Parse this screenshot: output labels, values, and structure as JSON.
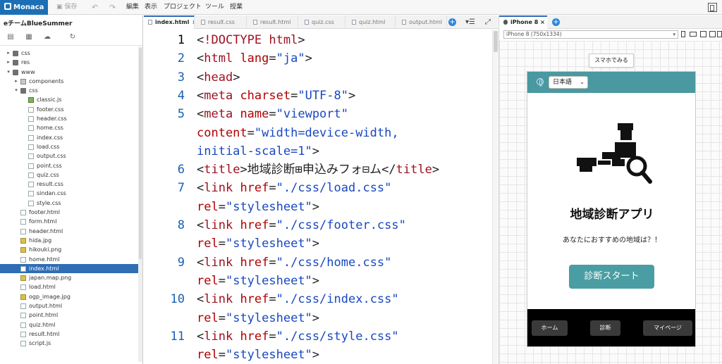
{
  "app": {
    "logo": "Monaca",
    "save_label": "保存",
    "menu": [
      "編集",
      "表示",
      "プロジェクト",
      "ツール",
      "授業"
    ]
  },
  "project": {
    "name": "eチームBlueSummer",
    "tree": [
      {
        "label": "css",
        "kind": "folder",
        "depth": 0,
        "arrow": "▸"
      },
      {
        "label": "res",
        "kind": "folder",
        "depth": 0,
        "arrow": "▸"
      },
      {
        "label": "www",
        "kind": "folder",
        "depth": 0,
        "arrow": "▾"
      },
      {
        "label": "components",
        "kind": "pkg",
        "depth": 1,
        "arrow": "▸"
      },
      {
        "label": "css",
        "kind": "folder",
        "depth": 1,
        "arrow": "▾"
      },
      {
        "label": "classic.js",
        "kind": "js",
        "depth": 2,
        "arrow": ""
      },
      {
        "label": "footer.css",
        "kind": "file",
        "depth": 2,
        "arrow": ""
      },
      {
        "label": "header.css",
        "kind": "file",
        "depth": 2,
        "arrow": ""
      },
      {
        "label": "home.css",
        "kind": "file",
        "depth": 2,
        "arrow": ""
      },
      {
        "label": "index.css",
        "kind": "file",
        "depth": 2,
        "arrow": ""
      },
      {
        "label": "load.css",
        "kind": "file",
        "depth": 2,
        "arrow": ""
      },
      {
        "label": "output.css",
        "kind": "file",
        "depth": 2,
        "arrow": ""
      },
      {
        "label": "point.css",
        "kind": "file",
        "depth": 2,
        "arrow": ""
      },
      {
        "label": "quiz.css",
        "kind": "file",
        "depth": 2,
        "arrow": ""
      },
      {
        "label": "result.css",
        "kind": "file",
        "depth": 2,
        "arrow": ""
      },
      {
        "label": "sindan.css",
        "kind": "file",
        "depth": 2,
        "arrow": ""
      },
      {
        "label": "style.css",
        "kind": "file",
        "depth": 2,
        "arrow": ""
      },
      {
        "label": "footer.html",
        "kind": "file",
        "depth": 1,
        "arrow": ""
      },
      {
        "label": "form.html",
        "kind": "file",
        "depth": 1,
        "arrow": ""
      },
      {
        "label": "header.html",
        "kind": "file",
        "depth": 1,
        "arrow": ""
      },
      {
        "label": "hida.jpg",
        "kind": "img",
        "depth": 1,
        "arrow": ""
      },
      {
        "label": "hikouki.png",
        "kind": "img",
        "depth": 1,
        "arrow": ""
      },
      {
        "label": "home.html",
        "kind": "file",
        "depth": 1,
        "arrow": ""
      },
      {
        "label": "index.html",
        "kind": "file",
        "depth": 1,
        "arrow": "",
        "selected": true
      },
      {
        "label": "japan.map.png",
        "kind": "img",
        "depth": 1,
        "arrow": ""
      },
      {
        "label": "load.html",
        "kind": "file",
        "depth": 1,
        "arrow": ""
      },
      {
        "label": "ogp_image.jpg",
        "kind": "img",
        "depth": 1,
        "arrow": ""
      },
      {
        "label": "output.html",
        "kind": "file",
        "depth": 1,
        "arrow": ""
      },
      {
        "label": "point.html",
        "kind": "file",
        "depth": 1,
        "arrow": ""
      },
      {
        "label": "quiz.html",
        "kind": "file",
        "depth": 1,
        "arrow": ""
      },
      {
        "label": "result.html",
        "kind": "file",
        "depth": 1,
        "arrow": ""
      },
      {
        "label": "script.js",
        "kind": "file",
        "depth": 1,
        "arrow": ""
      }
    ]
  },
  "editor": {
    "tabs": [
      {
        "label": "index.html",
        "active": true,
        "close": "×"
      },
      {
        "label": "result.css"
      },
      {
        "label": "result.html"
      },
      {
        "label": "quiz.css"
      },
      {
        "label": "quiz.html"
      },
      {
        "label": "output.html"
      }
    ],
    "plus": "+",
    "line_numbers": [
      "1",
      "2",
      "3",
      "4",
      "5",
      "6",
      "7",
      "8",
      "9",
      "10",
      "11"
    ],
    "lines": [
      {
        "num": "1",
        "parts": [
          [
            "tg",
            "<"
          ],
          [
            "tn",
            "!DOCTYPE "
          ],
          [
            "tn",
            "html"
          ],
          [
            "tg",
            ">"
          ]
        ]
      },
      {
        "num": "2",
        "parts": [
          [
            "tg",
            "<"
          ],
          [
            "tn",
            "html "
          ],
          [
            "ta",
            "lang"
          ],
          [
            "tg",
            "="
          ],
          [
            "tv",
            "\"ja\""
          ],
          [
            "tg",
            ">"
          ]
        ]
      },
      {
        "num": "3",
        "parts": [
          [
            "tg",
            "<"
          ],
          [
            "tn",
            "head"
          ],
          [
            "tg",
            ">"
          ]
        ]
      },
      {
        "num": "4",
        "parts": [
          [
            "tg",
            "<"
          ],
          [
            "tn",
            "meta "
          ],
          [
            "ta",
            "charset"
          ],
          [
            "tg",
            "="
          ],
          [
            "tv",
            "\"UTF-8\""
          ],
          [
            "tg",
            ">"
          ]
        ]
      },
      {
        "num": "5",
        "parts": [
          [
            "tg",
            "<"
          ],
          [
            "tn",
            "meta "
          ],
          [
            "ta",
            "name"
          ],
          [
            "tg",
            "="
          ],
          [
            "tv",
            "\"viewport\""
          ]
        ]
      },
      {
        "num": "",
        "parts": [
          [
            "ta",
            "content"
          ],
          [
            "tg",
            "="
          ],
          [
            "tv",
            "\"width=device-width,"
          ]
        ]
      },
      {
        "num": "",
        "parts": [
          [
            "tv",
            "initial-scale=1\""
          ],
          [
            "tg",
            ">"
          ]
        ]
      },
      {
        "num": "6",
        "parts": [
          [
            "tg",
            "<"
          ],
          [
            "tn",
            "title"
          ],
          [
            "tg",
            ">地域診断⊞申込みフォ⊟ム</"
          ],
          [
            "tn",
            "title"
          ],
          [
            "tg",
            ">"
          ]
        ]
      },
      {
        "num": "7",
        "parts": [
          [
            "tg",
            "<"
          ],
          [
            "tn",
            "link "
          ],
          [
            "ta",
            "href"
          ],
          [
            "tg",
            "="
          ],
          [
            "tv",
            "\"./css/load.css\""
          ]
        ]
      },
      {
        "num": "",
        "parts": [
          [
            "ta",
            "rel"
          ],
          [
            "tg",
            "="
          ],
          [
            "tv",
            "\"stylesheet\""
          ],
          [
            "tg",
            ">"
          ]
        ]
      },
      {
        "num": "8",
        "parts": [
          [
            "tg",
            "<"
          ],
          [
            "tn",
            "link "
          ],
          [
            "ta",
            "href"
          ],
          [
            "tg",
            "="
          ],
          [
            "tv",
            "\"./css/footer.css\""
          ]
        ]
      },
      {
        "num": "",
        "parts": [
          [
            "ta",
            "rel"
          ],
          [
            "tg",
            "="
          ],
          [
            "tv",
            "\"stylesheet\""
          ],
          [
            "tg",
            ">"
          ]
        ]
      },
      {
        "num": "9",
        "parts": [
          [
            "tg",
            "<"
          ],
          [
            "tn",
            "link "
          ],
          [
            "ta",
            "href"
          ],
          [
            "tg",
            "="
          ],
          [
            "tv",
            "\"./css/home.css\""
          ]
        ]
      },
      {
        "num": "",
        "parts": [
          [
            "ta",
            "rel"
          ],
          [
            "tg",
            "="
          ],
          [
            "tv",
            "\"stylesheet\""
          ],
          [
            "tg",
            ">"
          ]
        ]
      },
      {
        "num": "10",
        "parts": [
          [
            "tg",
            "<"
          ],
          [
            "tn",
            "link "
          ],
          [
            "ta",
            "href"
          ],
          [
            "tg",
            "="
          ],
          [
            "tv",
            "\"./css/index.css\""
          ]
        ]
      },
      {
        "num": "",
        "parts": [
          [
            "ta",
            "rel"
          ],
          [
            "tg",
            "="
          ],
          [
            "tv",
            "\"stylesheet\""
          ],
          [
            "tg",
            ">"
          ]
        ]
      },
      {
        "num": "11",
        "parts": [
          [
            "tg",
            "<"
          ],
          [
            "tn",
            "link "
          ],
          [
            "ta",
            "href"
          ],
          [
            "tg",
            "="
          ],
          [
            "tv",
            "\"./css/style.css\""
          ]
        ]
      },
      {
        "num": "",
        "parts": [
          [
            "ta",
            "rel"
          ],
          [
            "tg",
            "="
          ],
          [
            "tv",
            "\"stylesheet\""
          ],
          [
            "tg",
            ">"
          ]
        ]
      }
    ]
  },
  "preview": {
    "tab_label": "iPhone 8",
    "tab_close": "×",
    "plus": "+",
    "device": "iPhone 8 (750x1334)",
    "smartphone_button": "スマホでみる",
    "language": "日本語",
    "app_title": "地域診断アプリ",
    "subtitle": "あなたにおすすめの地域は？！",
    "start_button": "診断スタート",
    "footer_buttons": [
      "ホーム",
      "診断",
      "マイページ"
    ]
  },
  "colors": {
    "accent": "#2f6db5",
    "header_teal": "#4a98a0",
    "start_teal": "#4a9ea3"
  }
}
